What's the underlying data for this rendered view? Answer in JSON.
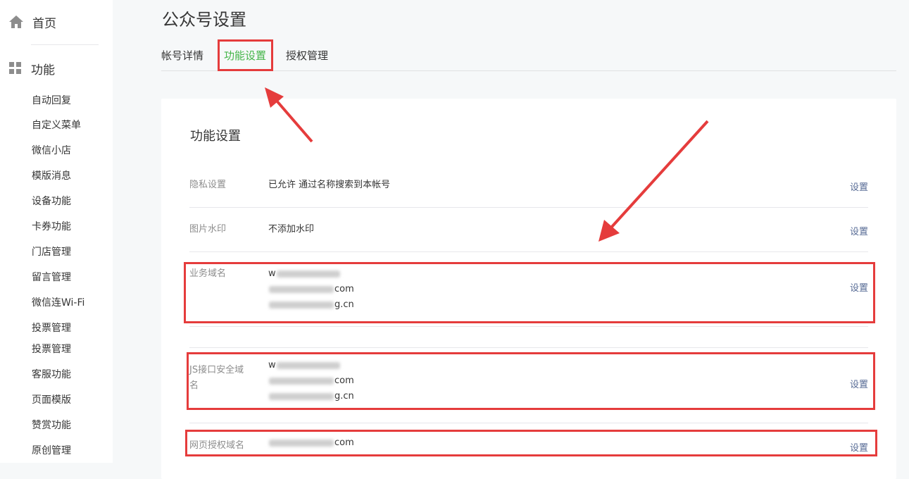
{
  "sidebar": {
    "home_label": "首页",
    "function_label": "功能",
    "items": [
      {
        "label": "自动回复"
      },
      {
        "label": "自定义菜单"
      },
      {
        "label": "微信小店"
      },
      {
        "label": "模版消息"
      },
      {
        "label": "设备功能"
      },
      {
        "label": "卡券功能"
      },
      {
        "label": "门店管理"
      },
      {
        "label": "留言管理"
      },
      {
        "label": "微信连Wi-Fi"
      },
      {
        "label": "投票管理"
      },
      {
        "label": "投票管理"
      },
      {
        "label": "客服功能"
      },
      {
        "label": "页面模版"
      },
      {
        "label": "赞赏功能"
      },
      {
        "label": "原创管理"
      }
    ]
  },
  "header": {
    "title": "公众号设置",
    "tabs": [
      {
        "label": "帐号详情"
      },
      {
        "label": "功能设置"
      },
      {
        "label": "授权管理"
      }
    ]
  },
  "card": {
    "title": "功能设置",
    "rows": {
      "privacy": {
        "label": "隐私设置",
        "value": "已允许 通过名称搜索到本帐号",
        "action": "设置"
      },
      "watermark": {
        "label": "图片水印",
        "value": "不添加水印",
        "action": "设置"
      },
      "business": {
        "label": "业务域名",
        "lines": [
          "w",
          "com",
          "g.cn"
        ],
        "action": "设置"
      },
      "js": {
        "label_line1": "JS接口安全域",
        "label_line2": "名",
        "lines": [
          "w",
          "com",
          "g.cn"
        ],
        "action": "设置"
      },
      "oauth": {
        "label": "网页授权域名",
        "lines": [
          "com"
        ],
        "action": "设置"
      }
    }
  },
  "colors": {
    "accent_green": "#44b549",
    "link_blue": "#576b95",
    "annotation_red": "#e53c3c"
  }
}
